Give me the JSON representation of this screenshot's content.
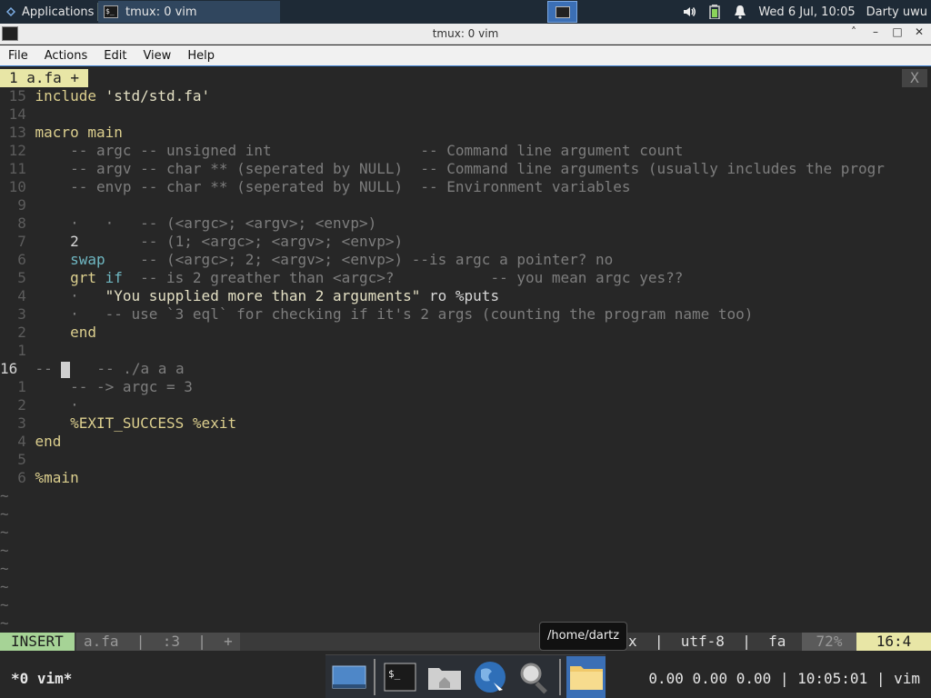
{
  "panel": {
    "apps_label": "Applications",
    "task_label": "tmux: 0 vim",
    "clock": "Wed  6 Jul, 10:05",
    "user": "Darty uwu",
    "icons": [
      "speaker-icon",
      "battery-icon",
      "bell-icon"
    ]
  },
  "window": {
    "title": "tmux: 0 vim",
    "controls": [
      "˄",
      "–",
      "□",
      "✕"
    ]
  },
  "menu": [
    "File",
    "Actions",
    "Edit",
    "View",
    "Help"
  ],
  "vim": {
    "tab_label": "1  a.fa  +",
    "tab_close": "X",
    "lines": [
      {
        "n": "15",
        "segs": [
          [
            "kw",
            "include "
          ],
          [
            "str",
            "'std/std.fa'"
          ]
        ]
      },
      {
        "n": "14",
        "segs": []
      },
      {
        "n": "13",
        "segs": [
          [
            "kw",
            "macro main"
          ]
        ]
      },
      {
        "n": "12",
        "segs": [
          [
            "com",
            "    -- argc -- unsigned int                 -- Command line argument count"
          ]
        ]
      },
      {
        "n": "11",
        "segs": [
          [
            "com",
            "    -- argv -- char ** (seperated by NULL)  -- Command line arguments (usually includes the progr"
          ]
        ]
      },
      {
        "n": "10",
        "segs": [
          [
            "com",
            "    -- envp -- char ** (seperated by NULL)  -- Environment variables"
          ]
        ]
      },
      {
        "n": "9",
        "segs": []
      },
      {
        "n": "8",
        "segs": [
          [
            "com",
            "    ·   ·   -- (<argc>; <argv>; <envp>)"
          ]
        ]
      },
      {
        "n": "7",
        "segs": [
          [
            "num",
            "    2       "
          ],
          [
            "com",
            "-- (1; <argc>; <argv>; <envp>)"
          ]
        ]
      },
      {
        "n": "6",
        "segs": [
          [
            "cyan",
            "    swap    "
          ],
          [
            "com",
            "-- (<argc>; 2; <argv>; <envp>) --is argc a pointer? no"
          ]
        ]
      },
      {
        "n": "5",
        "segs": [
          [
            "kw",
            "    grt "
          ],
          [
            "cyan",
            "if  "
          ],
          [
            "com",
            "-- is 2 greather than <argc>?           -- you mean argc yes??"
          ]
        ]
      },
      {
        "n": "4",
        "segs": [
          [
            "com",
            "    ·   "
          ],
          [
            "str",
            "\"You supplied more than 2 arguments\""
          ],
          [
            "num",
            " ro %puts"
          ]
        ]
      },
      {
        "n": "3",
        "segs": [
          [
            "com",
            "    ·   -- use `3 eql` for checking if it's 2 args (counting the program name too)"
          ]
        ]
      },
      {
        "n": "2",
        "segs": [
          [
            "kw",
            "    end"
          ]
        ]
      },
      {
        "n": "1",
        "segs": []
      },
      {
        "n": "16",
        "cur": true,
        "segs": [
          [
            "com",
            "-- "
          ],
          [
            "cursor",
            ""
          ],
          [
            "com",
            "   -- ./a a a"
          ]
        ]
      },
      {
        "n": "1",
        "segs": [
          [
            "com",
            "    -- -> argc = 3"
          ]
        ]
      },
      {
        "n": "2",
        "segs": [
          [
            "com",
            "    ·"
          ]
        ]
      },
      {
        "n": "3",
        "segs": [
          [
            "kw",
            "    %EXIT_SUCCESS %exit"
          ]
        ]
      },
      {
        "n": "4",
        "segs": [
          [
            "kw",
            "end"
          ]
        ]
      },
      {
        "n": "5",
        "segs": []
      },
      {
        "n": "6",
        "segs": [
          [
            "kw",
            "%main"
          ]
        ]
      }
    ],
    "tilde_count": 8,
    "status": {
      "mode": "INSERT",
      "file": "a.fa  |  :3  |  +",
      "info": "  unix  |  utf-8  |  fa ",
      "pct": "72%",
      "pos": "16:4"
    }
  },
  "tmux": {
    "window": "*0 vim*",
    "right": "0.00 0.00 0.00  |  10:05:01  |  vim"
  },
  "tooltip": "/home/dartz",
  "dock": [
    "desktop-icon",
    "terminal-icon",
    "home-folder-icon",
    "web-browser-icon",
    "search-icon",
    "folder-icon"
  ],
  "colors": {
    "accent": "#3b6fb5",
    "insert_mode": "#a6d396",
    "position": "#e8e6a6"
  }
}
